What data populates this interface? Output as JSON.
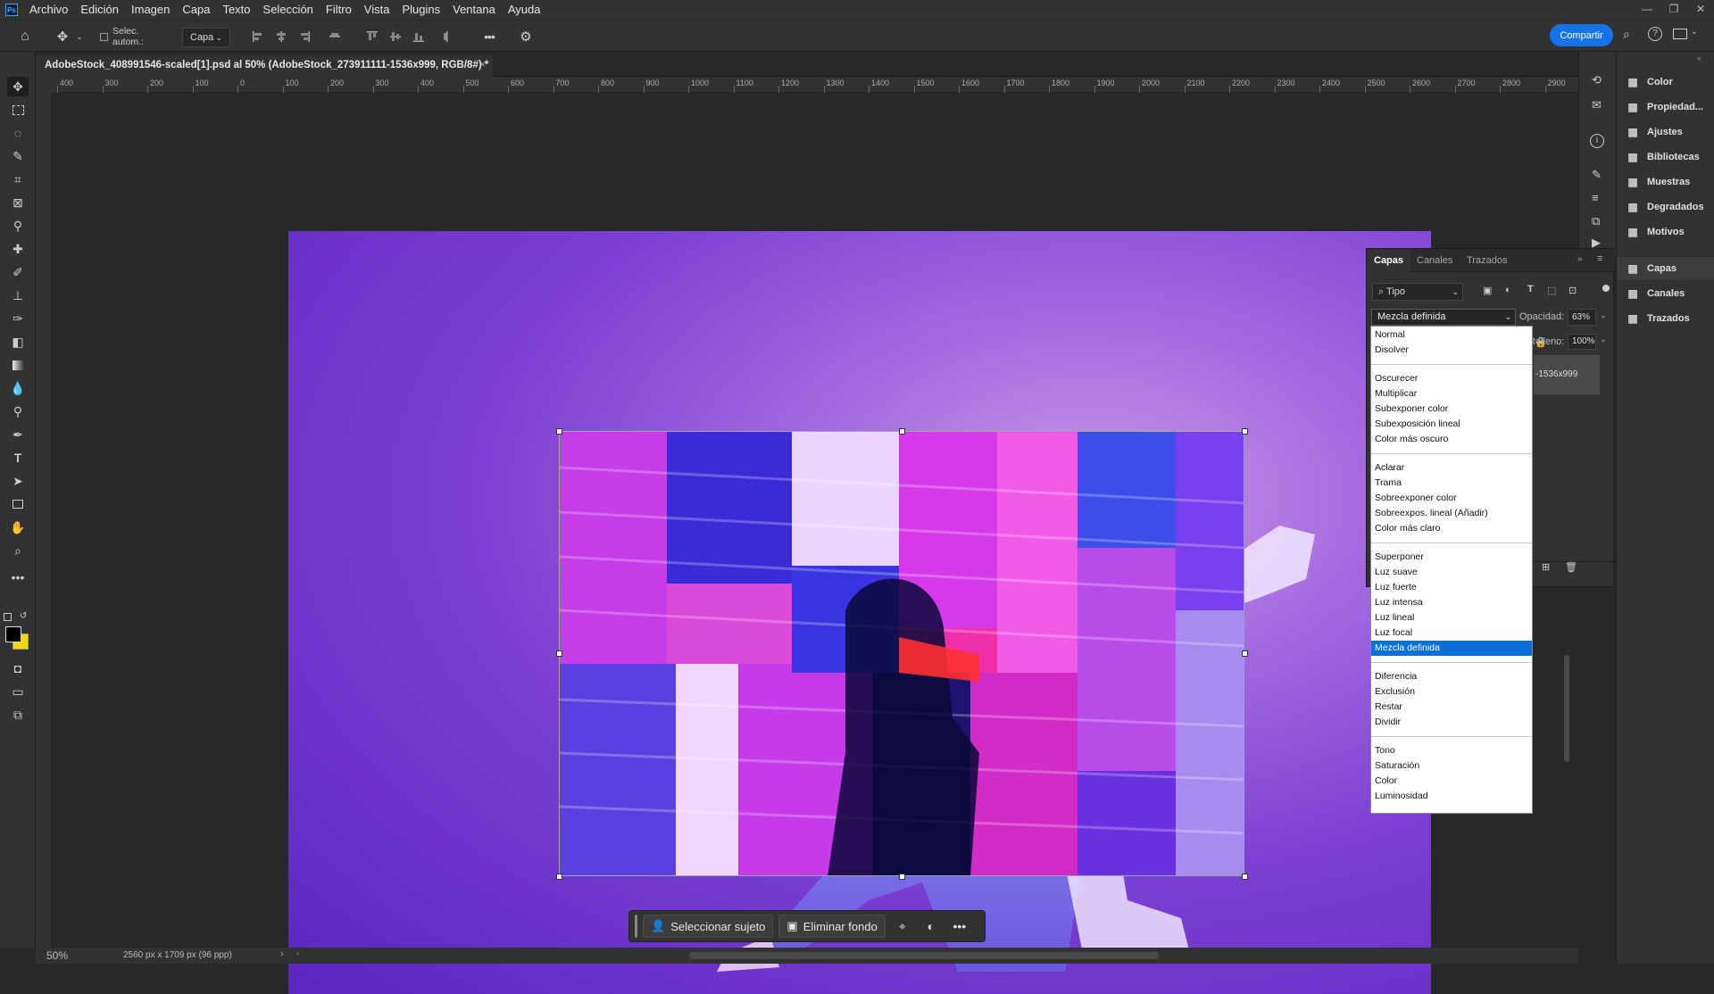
{
  "menubar": {
    "items": [
      "Archivo",
      "Edición",
      "Imagen",
      "Capa",
      "Texto",
      "Selección",
      "Filtro",
      "Vista",
      "Plugins",
      "Ventana",
      "Ayuda"
    ]
  },
  "options_bar": {
    "auto_select_label": "Selec. autom.:",
    "layer_select_value": "Capa",
    "more_label": "•••"
  },
  "share_button": "Compartir",
  "document_tab": {
    "title": "AdobeStock_408991546-scaled[1].psd al 50% (AdobeStock_273911111-1536x999, RGB/8#) *",
    "close": "×"
  },
  "ruler_top_labels": [
    "400",
    "300",
    "200",
    "100",
    "0",
    "100",
    "200",
    "300",
    "400",
    "500",
    "600",
    "700",
    "800",
    "900",
    "1000",
    "1100",
    "1200",
    "1300",
    "1400",
    "1500",
    "1600",
    "1700",
    "1800",
    "1900",
    "2000",
    "2100",
    "2200",
    "2300",
    "2400",
    "2500",
    "2600",
    "2700",
    "2800",
    "2900"
  ],
  "context_bar": {
    "select_subject": "Seleccionar sujeto",
    "remove_bg": "Eliminar fondo",
    "more": "•••"
  },
  "status_bar": {
    "zoom": "50%",
    "doc_info": "2560 px x 1709 px (96 ppp)"
  },
  "right_panels": {
    "items": [
      {
        "label": "Color",
        "icon": "color-wheel-icon"
      },
      {
        "label": "Propiedad...",
        "icon": "properties-icon"
      },
      {
        "label": "Ajustes",
        "icon": "adjustments-icon"
      },
      {
        "label": "Bibliotecas",
        "icon": "libraries-icon"
      },
      {
        "label": "Muestras",
        "icon": "swatches-icon"
      },
      {
        "label": "Degradados",
        "icon": "gradients-icon"
      },
      {
        "label": "Motivos",
        "icon": "patterns-icon"
      }
    ],
    "items2": [
      {
        "label": "Capas",
        "icon": "layers-icon"
      },
      {
        "label": "Canales",
        "icon": "channels-icon"
      },
      {
        "label": "Trazados",
        "icon": "paths-icon"
      }
    ]
  },
  "layers_panel": {
    "tabs": [
      "Capas",
      "Canales",
      "Trazados"
    ],
    "filter_placeholder": "Tipo",
    "blend_mode": "Mezcla definida",
    "opacity_label": "Opacidad:",
    "opacity_value": "63%",
    "fill_label": "Relleno:",
    "fill_value": "100%",
    "layer_name": "-1536x999"
  },
  "blend_modes": {
    "groups": [
      [
        "Normal",
        "Disolver"
      ],
      [
        "Oscurecer",
        "Multiplicar",
        "Subexponer color",
        "Subexposición lineal",
        "Color más oscuro"
      ],
      [
        "Aclarar",
        "Trama",
        "Sobreexponer color",
        "Sobreexpos. lineal (Añadir)",
        "Color más claro"
      ],
      [
        "Superponer",
        "Luz suave",
        "Luz fuerte",
        "Luz intensa",
        "Luz lineal",
        "Luz focal",
        "Mezcla definida"
      ],
      [
        "Diferencia",
        "Exclusión",
        "Restar",
        "Dividir"
      ],
      [
        "Tono",
        "Saturación",
        "Color",
        "Luminosidad"
      ]
    ],
    "selected": "Mezcla definida"
  },
  "colors": {
    "accent": "#1473e6",
    "panel_bg": "#323232",
    "canvas_bg": "#282828",
    "selection": "#0a6fd8",
    "foreground_swatch": "#000000",
    "background_swatch": "#f5d800"
  }
}
